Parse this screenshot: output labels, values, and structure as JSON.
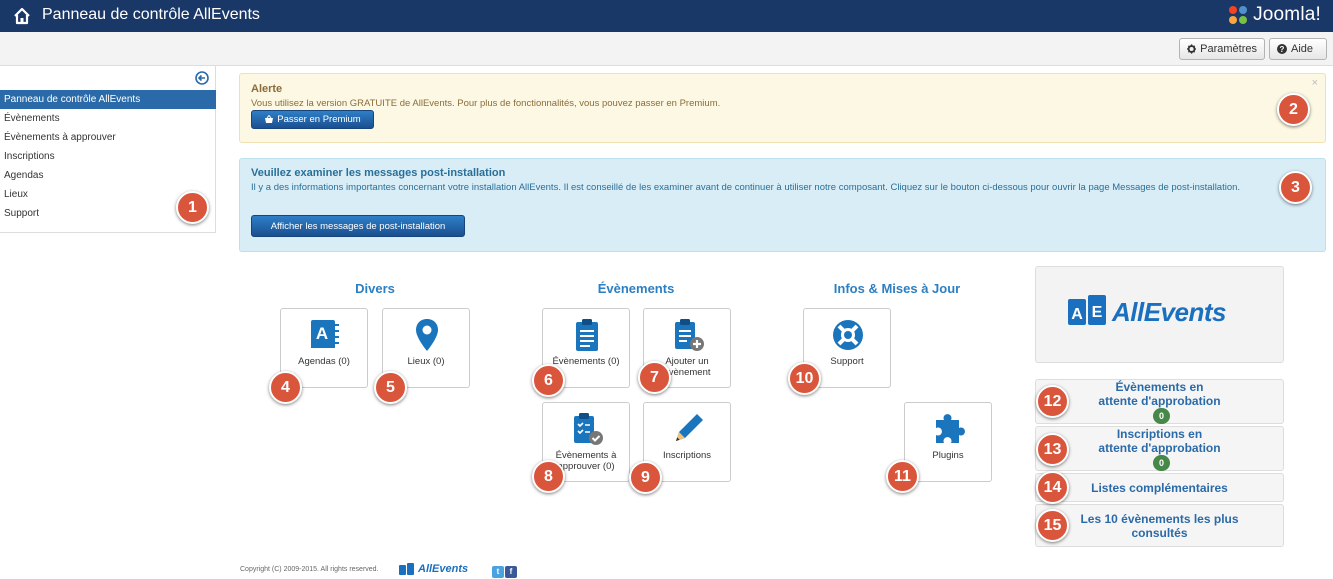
{
  "header": {
    "title": "Panneau de contrôle AllEvents",
    "brand": "Joomla!"
  },
  "toolbar": {
    "params_label": "Paramètres",
    "help_label": "Aide"
  },
  "sidebar": {
    "items": [
      {
        "label": "Panneau de contrôle AllEvents",
        "active": true
      },
      {
        "label": "Évènements"
      },
      {
        "label": "Évènements à approuver"
      },
      {
        "label": "Inscriptions"
      },
      {
        "label": "Agendas"
      },
      {
        "label": "Lieux"
      },
      {
        "label": "Support"
      }
    ]
  },
  "alert": {
    "title": "Alerte",
    "text": "Vous utilisez la version GRATUITE de AllEvents. Pour plus de fonctionnalités, vous pouvez passer en Premium.",
    "button": "Passer en Premium",
    "close": "×"
  },
  "postinstall": {
    "title": "Veuillez examiner les messages post-installation",
    "text": "Il y a des informations importantes concernant votre installation AllEvents. Il est conseillé de les examiner avant de continuer à utiliser notre composant. Cliquez sur le bouton ci-dessous pour ouvrir la page Messages de post-installation.",
    "button": "Afficher les messages de post-installation"
  },
  "sections": {
    "divers": "Divers",
    "evenements": "Évènements",
    "infos": "Infos & Mises à Jour"
  },
  "tiles": {
    "agendas": "Agendas (0)",
    "lieux": "Lieux (0)",
    "evenements": "Évènements (0)",
    "ajouter": "Ajouter un évènement",
    "approuver": "Évènements à approuver (0)",
    "inscriptions": "Inscriptions",
    "support": "Support",
    "plugins": "Plugins"
  },
  "right": {
    "logo_text": "AllEvents",
    "pending_events": "Évènements en attente d'approbation",
    "pending_events_count": "0",
    "pending_inscriptions": "Inscriptions en attente d'approbation",
    "pending_inscriptions_count": "0",
    "lists": "Listes complémentaires",
    "top10": "Les 10 évènements les plus consultés"
  },
  "markers": [
    "1",
    "2",
    "3",
    "4",
    "5",
    "6",
    "7",
    "8",
    "9",
    "10",
    "11",
    "12",
    "13",
    "14",
    "15"
  ],
  "footer": {
    "copyright": "Copyright (C) 2009-2015. All rights reserved.",
    "logo_text": "AllEvents",
    "twitter": "t",
    "facebook": "f"
  },
  "colors": {
    "header_bg": "#1a3867",
    "accent": "#2b6aa8",
    "marker": "#d9553b",
    "badge": "#468847"
  }
}
